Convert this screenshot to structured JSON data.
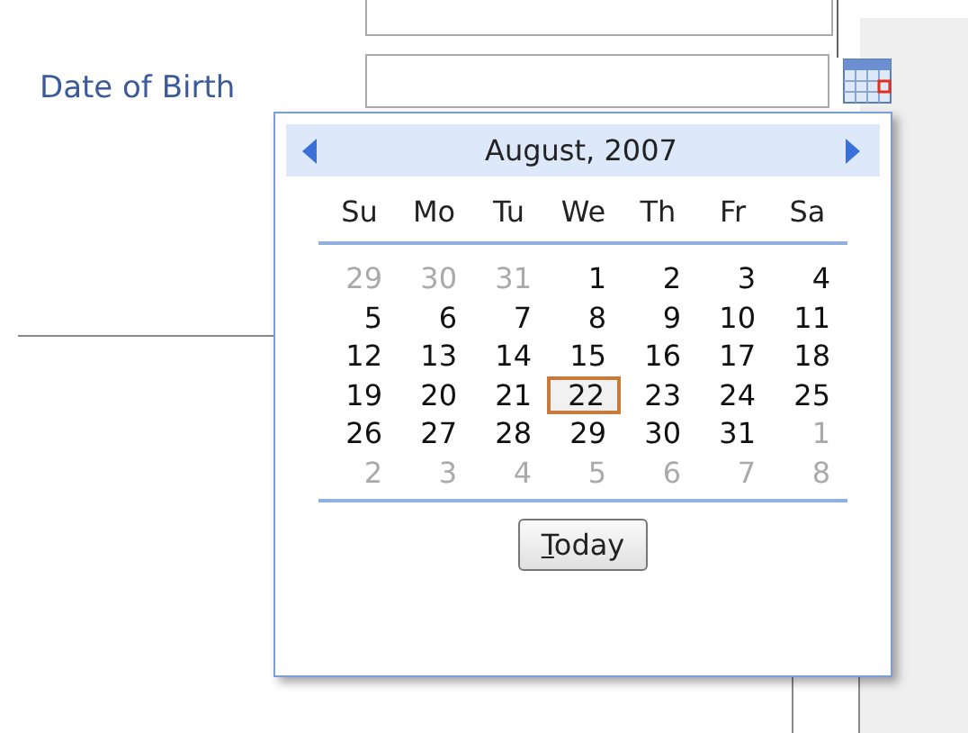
{
  "form": {
    "field_label": "Date of Birth"
  },
  "calendar": {
    "month_title": "August, 2007",
    "weekdays": [
      "Su",
      "Mo",
      "Tu",
      "We",
      "Th",
      "Fr",
      "Sa"
    ],
    "days": [
      {
        "label": "29",
        "other_month": true,
        "selected": false
      },
      {
        "label": "30",
        "other_month": true,
        "selected": false
      },
      {
        "label": "31",
        "other_month": true,
        "selected": false
      },
      {
        "label": "1",
        "other_month": false,
        "selected": false
      },
      {
        "label": "2",
        "other_month": false,
        "selected": false
      },
      {
        "label": "3",
        "other_month": false,
        "selected": false
      },
      {
        "label": "4",
        "other_month": false,
        "selected": false
      },
      {
        "label": "5",
        "other_month": false,
        "selected": false
      },
      {
        "label": "6",
        "other_month": false,
        "selected": false
      },
      {
        "label": "7",
        "other_month": false,
        "selected": false
      },
      {
        "label": "8",
        "other_month": false,
        "selected": false
      },
      {
        "label": "9",
        "other_month": false,
        "selected": false
      },
      {
        "label": "10",
        "other_month": false,
        "selected": false
      },
      {
        "label": "11",
        "other_month": false,
        "selected": false
      },
      {
        "label": "12",
        "other_month": false,
        "selected": false
      },
      {
        "label": "13",
        "other_month": false,
        "selected": false
      },
      {
        "label": "14",
        "other_month": false,
        "selected": false
      },
      {
        "label": "15",
        "other_month": false,
        "selected": false
      },
      {
        "label": "16",
        "other_month": false,
        "selected": false
      },
      {
        "label": "17",
        "other_month": false,
        "selected": false
      },
      {
        "label": "18",
        "other_month": false,
        "selected": false
      },
      {
        "label": "19",
        "other_month": false,
        "selected": false
      },
      {
        "label": "20",
        "other_month": false,
        "selected": false
      },
      {
        "label": "21",
        "other_month": false,
        "selected": false
      },
      {
        "label": "22",
        "other_month": false,
        "selected": true
      },
      {
        "label": "23",
        "other_month": false,
        "selected": false
      },
      {
        "label": "24",
        "other_month": false,
        "selected": false
      },
      {
        "label": "25",
        "other_month": false,
        "selected": false
      },
      {
        "label": "26",
        "other_month": false,
        "selected": false
      },
      {
        "label": "27",
        "other_month": false,
        "selected": false
      },
      {
        "label": "28",
        "other_month": false,
        "selected": false
      },
      {
        "label": "29",
        "other_month": false,
        "selected": false
      },
      {
        "label": "30",
        "other_month": false,
        "selected": false
      },
      {
        "label": "31",
        "other_month": false,
        "selected": false
      },
      {
        "label": "1",
        "other_month": true,
        "selected": false
      },
      {
        "label": "2",
        "other_month": true,
        "selected": false
      },
      {
        "label": "3",
        "other_month": true,
        "selected": false
      },
      {
        "label": "4",
        "other_month": true,
        "selected": false
      },
      {
        "label": "5",
        "other_month": true,
        "selected": false
      },
      {
        "label": "6",
        "other_month": true,
        "selected": false
      },
      {
        "label": "7",
        "other_month": true,
        "selected": false
      },
      {
        "label": "8",
        "other_month": true,
        "selected": false
      }
    ],
    "today_button": "Today"
  }
}
